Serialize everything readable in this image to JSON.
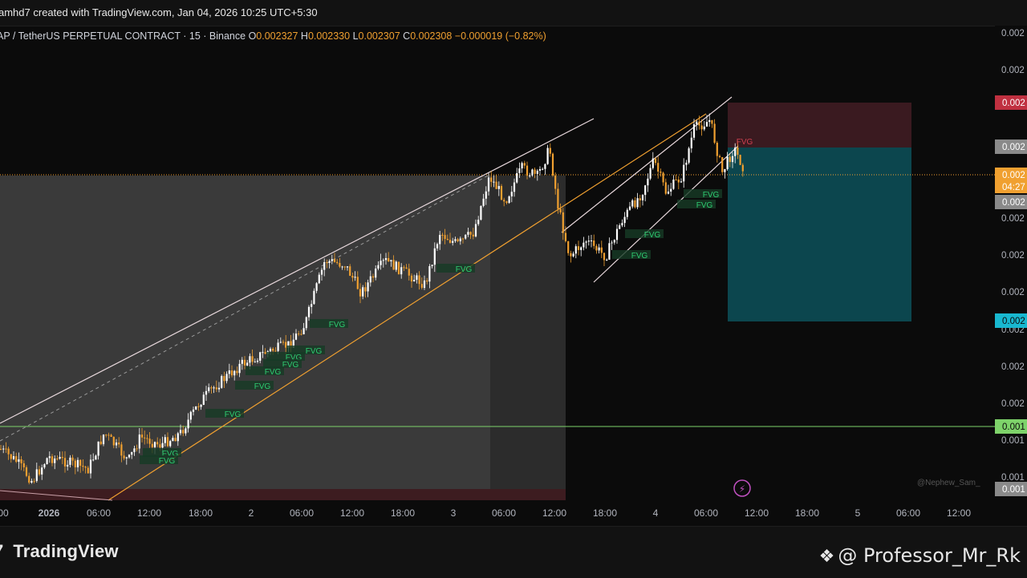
{
  "header": {
    "credit": "amhd7 created with TradingView.com, Jan 04, 2026 10:25 UTC+5:30"
  },
  "legend": {
    "symbol": "AP / TetherUS PERPETUAL CONTRACT · 15 · Binance",
    "o_label": "O",
    "o": "0.002327",
    "h_label": "H",
    "h": "0.002330",
    "l_label": "L",
    "l": "0.002307",
    "c_label": "C",
    "c": "0.002308",
    "change": "−0.000019 (−0.82%)"
  },
  "footer": {
    "logo_text": "TradingView",
    "watermark": "@ Professor_Mr_Rk",
    "author_tag": "@Nephew_Sam_"
  },
  "colors": {
    "background": "#0b0b0b",
    "candle_up": "#ffffff",
    "candle_down": "#f0a030",
    "fvg_text": "#2ecc71",
    "fvg_bg": "#163b25",
    "channel_line": "#e8d8dc",
    "support_line": "#f0a030",
    "stop_zone": "#3a1a20",
    "target_zone": "#0d4a52",
    "green_line": "#7ed36a",
    "current_price": "#f0a030",
    "stop_label": "#c03040",
    "target_label": "#18b8d0"
  },
  "chart_data": {
    "type": "candlestick",
    "symbol": "AP / TetherUS PERPETUAL CONTRACT",
    "interval": "15",
    "exchange": "Binance",
    "x_ticks": [
      "00",
      "2026",
      "06:00",
      "12:00",
      "18:00",
      "2",
      "06:00",
      "12:00",
      "18:00",
      "3",
      "06:00",
      "12:00",
      "18:00",
      "4",
      "06:00",
      "12:00",
      "18:00",
      "5",
      "06:00",
      "12:00"
    ],
    "y_tick_labels": [
      "0.002",
      "0.002",
      "0.002",
      "0.002",
      "0.002",
      "0.002",
      "0.002",
      "0.002",
      "0.002",
      "0.001",
      "0.001",
      "0.001"
    ],
    "price_tags": [
      {
        "label": "0.002",
        "role": "stop"
      },
      {
        "label": "0.002",
        "role": "entry"
      },
      {
        "label": "0.002",
        "sub": "04:27",
        "role": "current"
      },
      {
        "label": "0.002",
        "role": "gray"
      },
      {
        "label": "0.002",
        "role": "target"
      },
      {
        "label": "0.001",
        "role": "green-level"
      },
      {
        "label": "0.001",
        "role": "low"
      }
    ],
    "fvg_labels": [
      "FVG",
      "FVG",
      "FVG",
      "FVG",
      "FVG",
      "FVG",
      "FVG",
      "FVG",
      "FVG",
      "FVG",
      "FVG",
      "FVG",
      "FVG",
      "FVG",
      "FVG"
    ],
    "fvg_red_label": "FVG",
    "legend_ohlc": {
      "open": 0.002327,
      "high": 0.00233,
      "low": 0.002307,
      "close": 0.002308,
      "change": -1.9e-05,
      "change_pct": -0.82
    }
  }
}
